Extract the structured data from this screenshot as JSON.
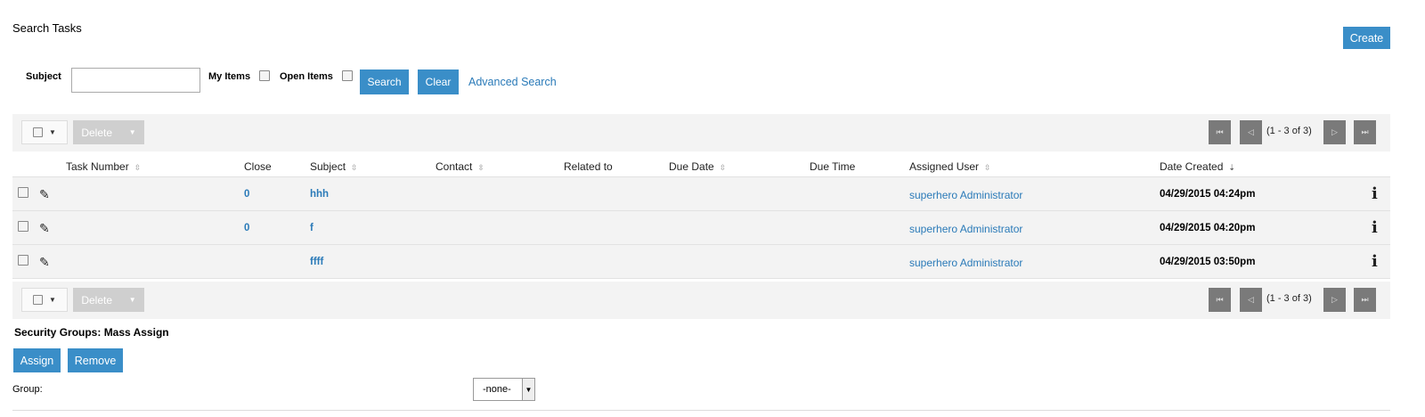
{
  "page": {
    "title": "Search Tasks"
  },
  "toolbar": {
    "create_label": "Create"
  },
  "search": {
    "subject_label": "Subject",
    "subject_value": "",
    "my_items_label": "My Items",
    "open_items_label": "Open Items",
    "search_label": "Search",
    "clear_label": "Clear",
    "advanced_label": "Advanced Search"
  },
  "actions": {
    "delete_label": "Delete"
  },
  "pagination": {
    "range_text": "(1 - 3 of 3)"
  },
  "table": {
    "columns": [
      "Task Number",
      "Close",
      "Subject",
      "Contact",
      "Related to",
      "Due Date",
      "Due Time",
      "Assigned User",
      "Date Created"
    ],
    "rows": [
      {
        "task_number": "",
        "close": "0",
        "subject": "hhh",
        "contact": "",
        "related_to": "",
        "due_date": "",
        "due_time": "",
        "assigned_user": "superhero Administrator",
        "date_created": "04/29/2015 04:24pm"
      },
      {
        "task_number": "",
        "close": "0",
        "subject": "f",
        "contact": "",
        "related_to": "",
        "due_date": "",
        "due_time": "",
        "assigned_user": "superhero Administrator",
        "date_created": "04/29/2015 04:20pm"
      },
      {
        "task_number": "",
        "close": "",
        "subject": "ffff",
        "contact": "",
        "related_to": "",
        "due_date": "",
        "due_time": "",
        "assigned_user": "superhero Administrator",
        "date_created": "04/29/2015 03:50pm"
      }
    ]
  },
  "security_groups": {
    "title": "Security Groups: Mass Assign",
    "assign_label": "Assign",
    "remove_label": "Remove",
    "group_label": "Group:",
    "group_value": "-none-"
  },
  "icons": {
    "edit": "pencil-icon",
    "info": "info-icon",
    "first": "first-page-icon",
    "prev": "prev-page-icon",
    "next": "next-page-icon",
    "last": "last-page-icon"
  },
  "colors": {
    "accent": "#3a8ec8",
    "link": "#2a7ab8",
    "pager": "#7a7a7a",
    "disabled": "#cfcfcf"
  }
}
